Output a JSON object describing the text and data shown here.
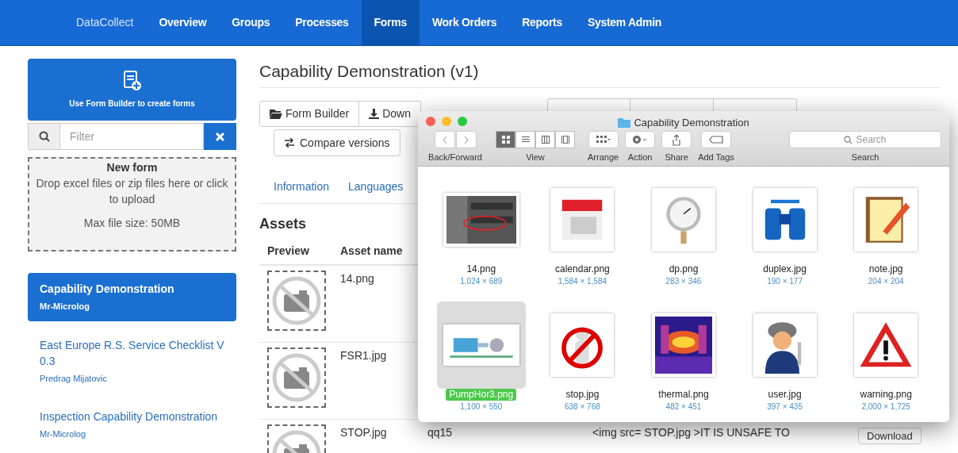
{
  "nav": {
    "brand": "DataCollect",
    "items": [
      {
        "label": "Overview",
        "selected": false
      },
      {
        "label": "Groups",
        "selected": false
      },
      {
        "label": "Processes",
        "selected": false
      },
      {
        "label": "Forms",
        "selected": true
      },
      {
        "label": "Work Orders",
        "selected": false
      },
      {
        "label": "Reports",
        "selected": false
      },
      {
        "label": "System Admin",
        "selected": false
      }
    ]
  },
  "sidebar": {
    "create_button": "Use Form Builder to create forms",
    "filter": {
      "placeholder": "Filter"
    },
    "dropzone": {
      "title": "New form",
      "text": "Drop excel files or zip files here or click to upload",
      "limit": "Max file size: 50MB"
    },
    "forms": [
      {
        "title": "Capability Demonstration",
        "author": "Mr-Microlog",
        "selected": true
      },
      {
        "title": "East Europe R.S. Service Checklist V 0.3",
        "author": "Predrag Mijatovic",
        "selected": false
      },
      {
        "title": "Inspection Capability Demonstration",
        "author": "Mr-Microlog",
        "selected": false
      }
    ]
  },
  "main": {
    "title": "Capability Demonstration (v1)",
    "toolbar": [
      "Form Builder",
      "Down"
    ],
    "compare_button": "Compare versions",
    "tabs": [
      {
        "label": "Information",
        "selected": false
      },
      {
        "label": "Languages",
        "selected": false
      }
    ],
    "assets": {
      "title": "Assets",
      "columns": [
        "Preview",
        "Asset name"
      ],
      "rows": [
        {
          "name": "14.png"
        },
        {
          "name": "FSR1.jpg"
        },
        {
          "name": "STOP.jpg",
          "column_3": "qq15",
          "column_4": "<img src= STOP.jpg >IT IS UNSAFE TO",
          "button": "Download"
        }
      ]
    }
  },
  "finder": {
    "title": "Capability Demonstration",
    "labels": [
      "Back/Forward",
      "View",
      "Arrange",
      "Action",
      "Share",
      "Add Tags"
    ],
    "search": {
      "placeholder": "Search",
      "label": "Search"
    },
    "view_modes": [
      {
        "selected": true
      },
      {
        "selected": false
      },
      {
        "selected": false
      },
      {
        "selected": false
      }
    ],
    "files": [
      {
        "name": "14.png",
        "size": "1,024 × 689",
        "selected": false
      },
      {
        "name": "calendar.png",
        "size": "1,584 × 1,584",
        "selected": false
      },
      {
        "name": "dp.png",
        "size": "283 × 346",
        "selected": false
      },
      {
        "name": "duplex.jpg",
        "size": "190 × 177",
        "selected": false
      },
      {
        "name": "note.jpg",
        "size": "204 × 204",
        "selected": false
      },
      {
        "name": "PumpHor3.png",
        "size": "1,100 × 550",
        "selected": true
      },
      {
        "name": "stop.jpg",
        "size": "638 × 768",
        "selected": false
      },
      {
        "name": "thermal.png",
        "size": "482 × 451",
        "selected": false
      },
      {
        "name": "user.jpg",
        "size": "397 × 435",
        "selected": false
      },
      {
        "name": "warning.png",
        "size": "2,000 × 1,725",
        "selected": false
      }
    ]
  }
}
